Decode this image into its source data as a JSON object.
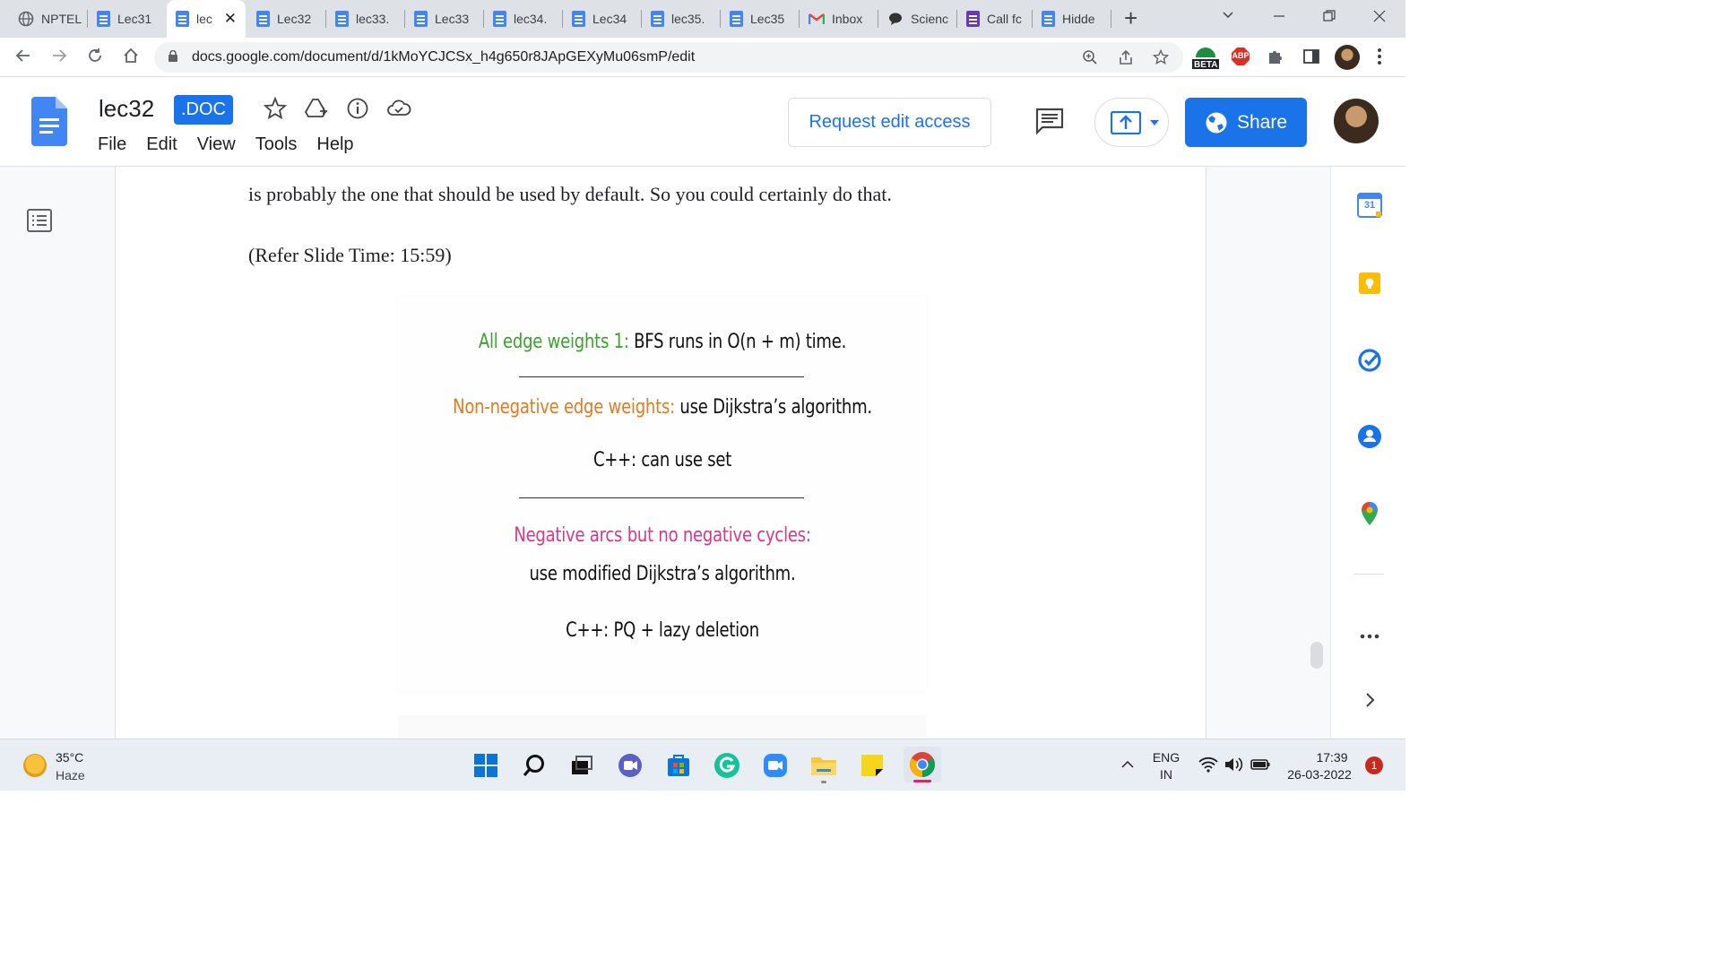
{
  "browser": {
    "tabs": [
      {
        "label": "NPTEL",
        "icon": "globe-icon"
      },
      {
        "label": "Lec31",
        "icon": "docs-icon"
      },
      {
        "label": "lec",
        "icon": "docs-icon",
        "active": true
      },
      {
        "label": "Lec32",
        "icon": "docs-icon"
      },
      {
        "label": "lec33.",
        "icon": "docs-icon"
      },
      {
        "label": "Lec33",
        "icon": "docs-icon"
      },
      {
        "label": "lec34.",
        "icon": "docs-icon"
      },
      {
        "label": "Lec34",
        "icon": "docs-icon"
      },
      {
        "label": "lec35.",
        "icon": "docs-icon"
      },
      {
        "label": "Lec35",
        "icon": "docs-icon"
      },
      {
        "label": "Inbox",
        "icon": "gmail-icon"
      },
      {
        "label": "Scienc",
        "icon": "chat-icon"
      },
      {
        "label": "Call fc",
        "icon": "forms-icon"
      },
      {
        "label": "Hidde",
        "icon": "docs-icon"
      }
    ],
    "url": "docs.google.com/document/d/1kMoYCJCSx_h4g650r8JApGEXyMu06smP/edit",
    "extension_beta_label": "BETA",
    "extension_abp_label": "ABP"
  },
  "docs": {
    "title": "lec32",
    "badge": ".DOC",
    "menu": [
      "File",
      "Edit",
      "View",
      "Tools",
      "Help"
    ],
    "request_edit_label": "Request edit access",
    "share_label": "Share"
  },
  "document": {
    "para1": "is probably the one that should be used by default. So you could certainly do that.",
    "para2": "(Refer Slide Time: 15:59)",
    "slide": {
      "line1_highlight": "All edge weights 1:",
      "line1_rest": " BFS runs in O(n + m) time.",
      "line2_highlight": "Non-negative edge weights:",
      "line2_rest": " use Dijkstra’s algorithm.",
      "line3": "C++: can use set",
      "line4_highlight": "Negative arcs but no negative cycles:",
      "line5": "use modified Dijkstra’s algorithm.",
      "line6": "C++: PQ + lazy deletion"
    },
    "calendar_day": "31"
  },
  "taskbar": {
    "temperature": "35°C",
    "weather": "Haze",
    "lang_top": "ENG",
    "lang_bottom": "IN",
    "time": "17:39",
    "date": "26-03-2022",
    "notification_count": "1"
  }
}
